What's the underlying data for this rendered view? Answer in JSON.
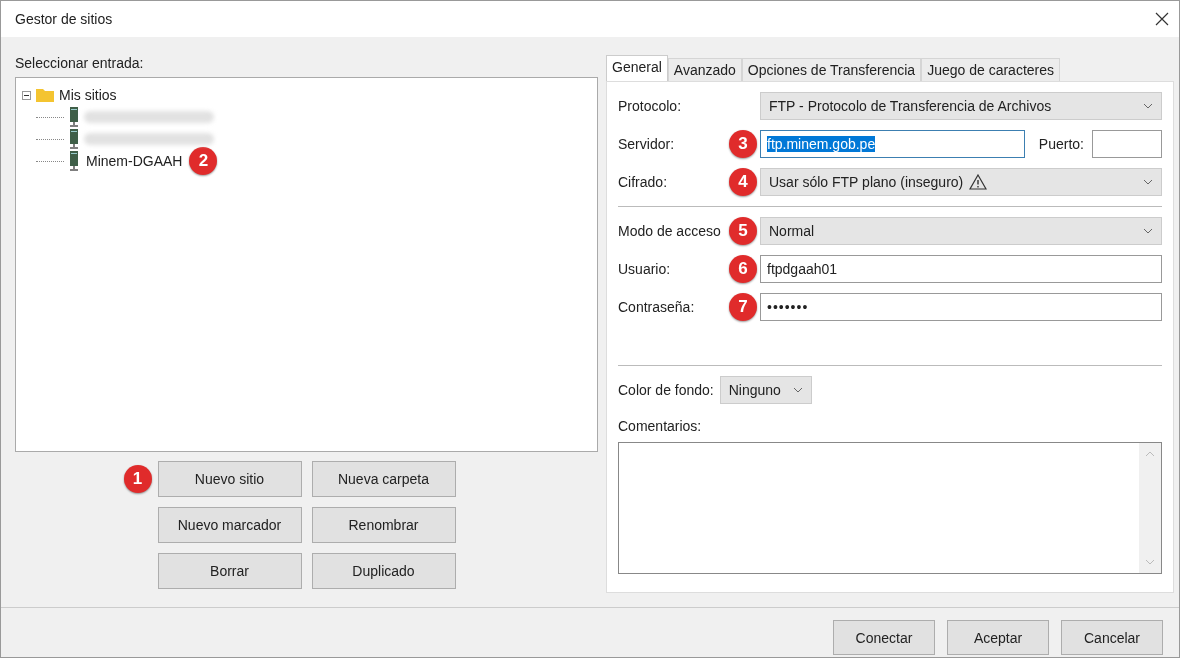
{
  "window": {
    "title": "Gestor de sitios"
  },
  "tree": {
    "label": "Seleccionar entrada:",
    "root": {
      "label": "Mis sitios",
      "expanded": true,
      "children": [
        {
          "kind": "blurred"
        },
        {
          "kind": "blurred"
        },
        {
          "kind": "site",
          "label": "Minem-DGAAH",
          "badge": "2"
        }
      ]
    }
  },
  "site_buttons": [
    {
      "label": "Nuevo sitio",
      "badge": "1"
    },
    {
      "label": "Nueva carpeta"
    },
    {
      "label": "Nuevo marcador"
    },
    {
      "label": "Renombrar"
    },
    {
      "label": "Borrar"
    },
    {
      "label": "Duplicado"
    }
  ],
  "tabs": [
    {
      "label": "General",
      "selected": true
    },
    {
      "label": "Avanzado",
      "selected": false
    },
    {
      "label": "Opciones de Transferencia",
      "selected": false
    },
    {
      "label": "Juego de caracteres",
      "selected": false
    }
  ],
  "form": [
    {
      "kind": "select",
      "label": "Protocolo:",
      "value": "FTP - Protocolo de Transferencia de Archivos",
      "warning": false
    },
    {
      "kind": "server",
      "label": "Servidor:",
      "badge": "3",
      "value": "ftp.minem.gob.pe",
      "highlighted": true,
      "port_label": "Puerto:"
    },
    {
      "kind": "select",
      "label": "Cifrado:",
      "badge": "4",
      "value": "Usar sólo FTP plano (inseguro)",
      "warning": true
    },
    {
      "kind": "separator"
    },
    {
      "kind": "select",
      "label": "Modo de acceso",
      "badge": "5",
      "value": "Normal",
      "warning": false
    },
    {
      "kind": "text",
      "label": "Usuario:",
      "badge": "6",
      "value": "ftpdgaah01"
    },
    {
      "kind": "password",
      "label": "Contraseña:",
      "badge": "7",
      "value": "•••••••"
    }
  ],
  "background_color": {
    "label": "Color de fondo:",
    "value": "Ninguno"
  },
  "comments": {
    "label": "Comentarios:"
  },
  "dialog_buttons": [
    "Conectar",
    "Aceptar",
    "Cancelar"
  ]
}
